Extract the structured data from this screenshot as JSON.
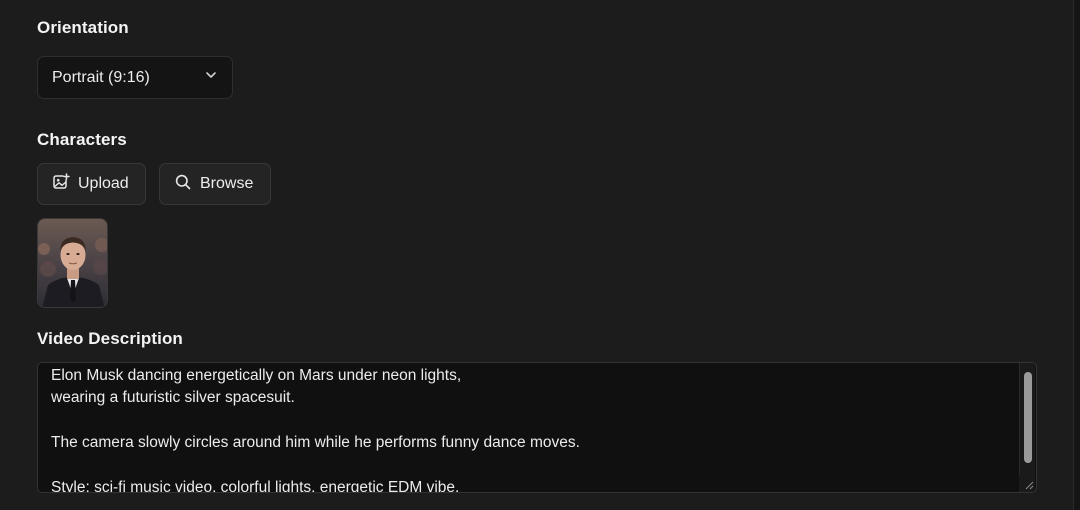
{
  "orientation": {
    "label": "Orientation",
    "selected": "Portrait (9:16)",
    "icon": "chevron-down-icon"
  },
  "characters": {
    "label": "Characters",
    "upload_label": "Upload",
    "upload_icon": "image-plus-icon",
    "browse_label": "Browse",
    "browse_icon": "search-icon"
  },
  "video_description": {
    "label": "Video Description",
    "text": "Elon Musk dancing energetically on Mars under neon lights,\nwearing a futuristic silver spacesuit.\n\nThe camera slowly circles around him while he performs funny dance moves.\n\nStyle: sci-fi music video, colorful lights, energetic EDM vibe."
  },
  "colors": {
    "background": "#1c1c1c",
    "input_background": "#101010",
    "button_background": "#242424",
    "text": "#f2f2f2"
  }
}
